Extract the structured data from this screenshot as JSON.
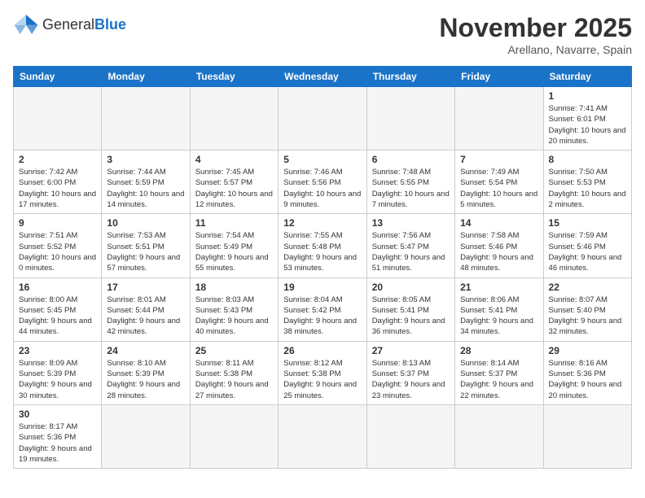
{
  "header": {
    "logo_general": "General",
    "logo_blue": "Blue",
    "month_title": "November 2025",
    "subtitle": "Arellano, Navarre, Spain"
  },
  "weekdays": [
    "Sunday",
    "Monday",
    "Tuesday",
    "Wednesday",
    "Thursday",
    "Friday",
    "Saturday"
  ],
  "weeks": [
    [
      {
        "day": "",
        "info": ""
      },
      {
        "day": "",
        "info": ""
      },
      {
        "day": "",
        "info": ""
      },
      {
        "day": "",
        "info": ""
      },
      {
        "day": "",
        "info": ""
      },
      {
        "day": "",
        "info": ""
      },
      {
        "day": "1",
        "info": "Sunrise: 7:41 AM\nSunset: 6:01 PM\nDaylight: 10 hours and 20 minutes."
      }
    ],
    [
      {
        "day": "2",
        "info": "Sunrise: 7:42 AM\nSunset: 6:00 PM\nDaylight: 10 hours and 17 minutes."
      },
      {
        "day": "3",
        "info": "Sunrise: 7:44 AM\nSunset: 5:59 PM\nDaylight: 10 hours and 14 minutes."
      },
      {
        "day": "4",
        "info": "Sunrise: 7:45 AM\nSunset: 5:57 PM\nDaylight: 10 hours and 12 minutes."
      },
      {
        "day": "5",
        "info": "Sunrise: 7:46 AM\nSunset: 5:56 PM\nDaylight: 10 hours and 9 minutes."
      },
      {
        "day": "6",
        "info": "Sunrise: 7:48 AM\nSunset: 5:55 PM\nDaylight: 10 hours and 7 minutes."
      },
      {
        "day": "7",
        "info": "Sunrise: 7:49 AM\nSunset: 5:54 PM\nDaylight: 10 hours and 5 minutes."
      },
      {
        "day": "8",
        "info": "Sunrise: 7:50 AM\nSunset: 5:53 PM\nDaylight: 10 hours and 2 minutes."
      }
    ],
    [
      {
        "day": "9",
        "info": "Sunrise: 7:51 AM\nSunset: 5:52 PM\nDaylight: 10 hours and 0 minutes."
      },
      {
        "day": "10",
        "info": "Sunrise: 7:53 AM\nSunset: 5:51 PM\nDaylight: 9 hours and 57 minutes."
      },
      {
        "day": "11",
        "info": "Sunrise: 7:54 AM\nSunset: 5:49 PM\nDaylight: 9 hours and 55 minutes."
      },
      {
        "day": "12",
        "info": "Sunrise: 7:55 AM\nSunset: 5:48 PM\nDaylight: 9 hours and 53 minutes."
      },
      {
        "day": "13",
        "info": "Sunrise: 7:56 AM\nSunset: 5:47 PM\nDaylight: 9 hours and 51 minutes."
      },
      {
        "day": "14",
        "info": "Sunrise: 7:58 AM\nSunset: 5:46 PM\nDaylight: 9 hours and 48 minutes."
      },
      {
        "day": "15",
        "info": "Sunrise: 7:59 AM\nSunset: 5:46 PM\nDaylight: 9 hours and 46 minutes."
      }
    ],
    [
      {
        "day": "16",
        "info": "Sunrise: 8:00 AM\nSunset: 5:45 PM\nDaylight: 9 hours and 44 minutes."
      },
      {
        "day": "17",
        "info": "Sunrise: 8:01 AM\nSunset: 5:44 PM\nDaylight: 9 hours and 42 minutes."
      },
      {
        "day": "18",
        "info": "Sunrise: 8:03 AM\nSunset: 5:43 PM\nDaylight: 9 hours and 40 minutes."
      },
      {
        "day": "19",
        "info": "Sunrise: 8:04 AM\nSunset: 5:42 PM\nDaylight: 9 hours and 38 minutes."
      },
      {
        "day": "20",
        "info": "Sunrise: 8:05 AM\nSunset: 5:41 PM\nDaylight: 9 hours and 36 minutes."
      },
      {
        "day": "21",
        "info": "Sunrise: 8:06 AM\nSunset: 5:41 PM\nDaylight: 9 hours and 34 minutes."
      },
      {
        "day": "22",
        "info": "Sunrise: 8:07 AM\nSunset: 5:40 PM\nDaylight: 9 hours and 32 minutes."
      }
    ],
    [
      {
        "day": "23",
        "info": "Sunrise: 8:09 AM\nSunset: 5:39 PM\nDaylight: 9 hours and 30 minutes."
      },
      {
        "day": "24",
        "info": "Sunrise: 8:10 AM\nSunset: 5:39 PM\nDaylight: 9 hours and 28 minutes."
      },
      {
        "day": "25",
        "info": "Sunrise: 8:11 AM\nSunset: 5:38 PM\nDaylight: 9 hours and 27 minutes."
      },
      {
        "day": "26",
        "info": "Sunrise: 8:12 AM\nSunset: 5:38 PM\nDaylight: 9 hours and 25 minutes."
      },
      {
        "day": "27",
        "info": "Sunrise: 8:13 AM\nSunset: 5:37 PM\nDaylight: 9 hours and 23 minutes."
      },
      {
        "day": "28",
        "info": "Sunrise: 8:14 AM\nSunset: 5:37 PM\nDaylight: 9 hours and 22 minutes."
      },
      {
        "day": "29",
        "info": "Sunrise: 8:16 AM\nSunset: 5:36 PM\nDaylight: 9 hours and 20 minutes."
      }
    ],
    [
      {
        "day": "30",
        "info": "Sunrise: 8:17 AM\nSunset: 5:36 PM\nDaylight: 9 hours and 19 minutes."
      },
      {
        "day": "",
        "info": ""
      },
      {
        "day": "",
        "info": ""
      },
      {
        "day": "",
        "info": ""
      },
      {
        "day": "",
        "info": ""
      },
      {
        "day": "",
        "info": ""
      },
      {
        "day": "",
        "info": ""
      }
    ]
  ]
}
